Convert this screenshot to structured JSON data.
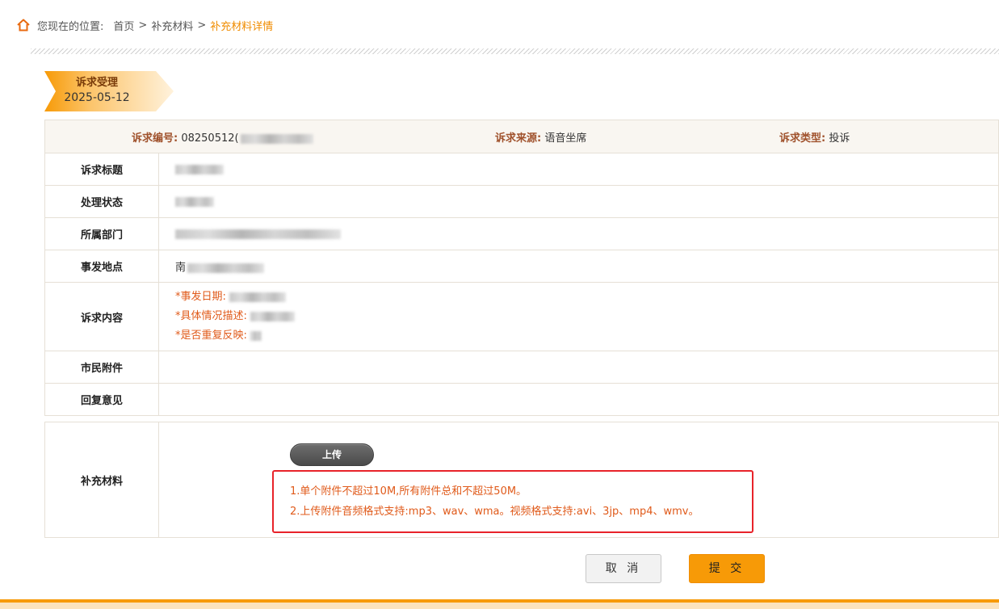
{
  "breadcrumb": {
    "prefix": "您现在的位置:",
    "items": [
      "首页",
      "补充材料",
      "补充材料详情"
    ],
    "separator": ">"
  },
  "ribbon": {
    "title": "诉求受理",
    "date": "2025-05-12"
  },
  "header": {
    "code_label": "诉求编号:",
    "code_value": "08250512(",
    "source_label": "诉求来源:",
    "source_value": "语音坐席",
    "type_label": "诉求类型:",
    "type_value": "投诉"
  },
  "rows": {
    "title_label": "诉求标题",
    "status_label": "处理状态",
    "dept_label": "所属部门",
    "location_label": "事发地点",
    "location_value": "南",
    "content_label": "诉求内容",
    "content_lines": [
      "*事发日期:",
      "*具体情况描述:",
      "*是否重复反映:"
    ],
    "attachments_label": "市民附件",
    "reply_label": "回复意见"
  },
  "supplement": {
    "label": "补充材料",
    "upload_label": "上传",
    "notes": [
      "1.单个附件不超过10M,所有附件总和不超过50M。",
      "2.上传附件音频格式支持:mp3、wav、wma。视频格式支持:avi、3jp、mp4、wmv。"
    ]
  },
  "actions": {
    "cancel_label": "取 消",
    "submit_label": "提 交"
  },
  "colors": {
    "accent": "#f79a07",
    "note_text": "#e05a1a",
    "note_border": "#e8232a",
    "label_key": "#a0522d"
  }
}
